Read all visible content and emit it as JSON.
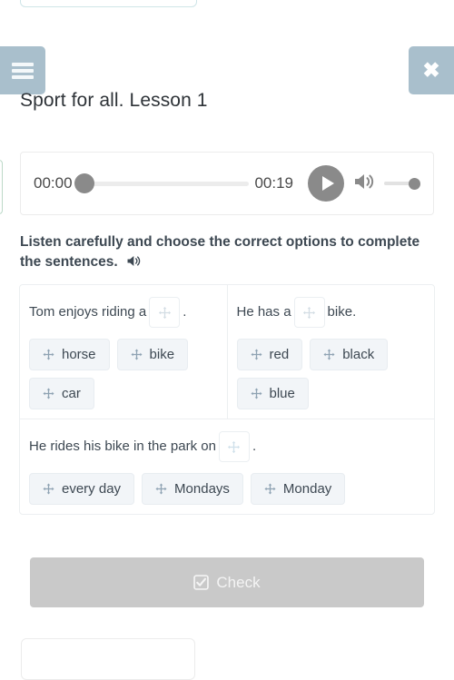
{
  "header": {
    "menu_icon": "hamburger-menu-icon",
    "close_icon": "close-x-icon",
    "title": "Sport for all. Lesson 1",
    "button_color": "#a9bfcc"
  },
  "audio_player": {
    "current_time": "00:00",
    "total_time": "00:19",
    "progress_percent": 0,
    "play_icon": "play-icon",
    "volume_icon": "volume-up-icon",
    "volume_percent": 100,
    "accent_color": "#8a8a8a"
  },
  "instruction": {
    "text": "Listen carefully and choose the correct options to complete the sentences.",
    "speaker_icon": "volume-up-icon"
  },
  "exercise": {
    "dropzone_icon": "arrows-move-icon",
    "chip_icon": "arrows-move-icon",
    "rows": [
      {
        "columns": [
          {
            "prefix": "Tom enjoys riding a",
            "suffix": ".",
            "chips": [
              "horse",
              "bike",
              "car"
            ]
          },
          {
            "prefix": "He has a",
            "suffix": "bike.",
            "chips": [
              "red",
              "black",
              "blue"
            ]
          }
        ]
      },
      {
        "columns": [
          {
            "prefix": "He rides his bike in the park on",
            "suffix": ".",
            "chips": [
              "every day",
              "Mondays",
              "Monday"
            ]
          }
        ]
      }
    ]
  },
  "check_button": {
    "label": "Check",
    "icon": "check-square-icon",
    "disabled": true,
    "color": "#c9c9c9"
  }
}
